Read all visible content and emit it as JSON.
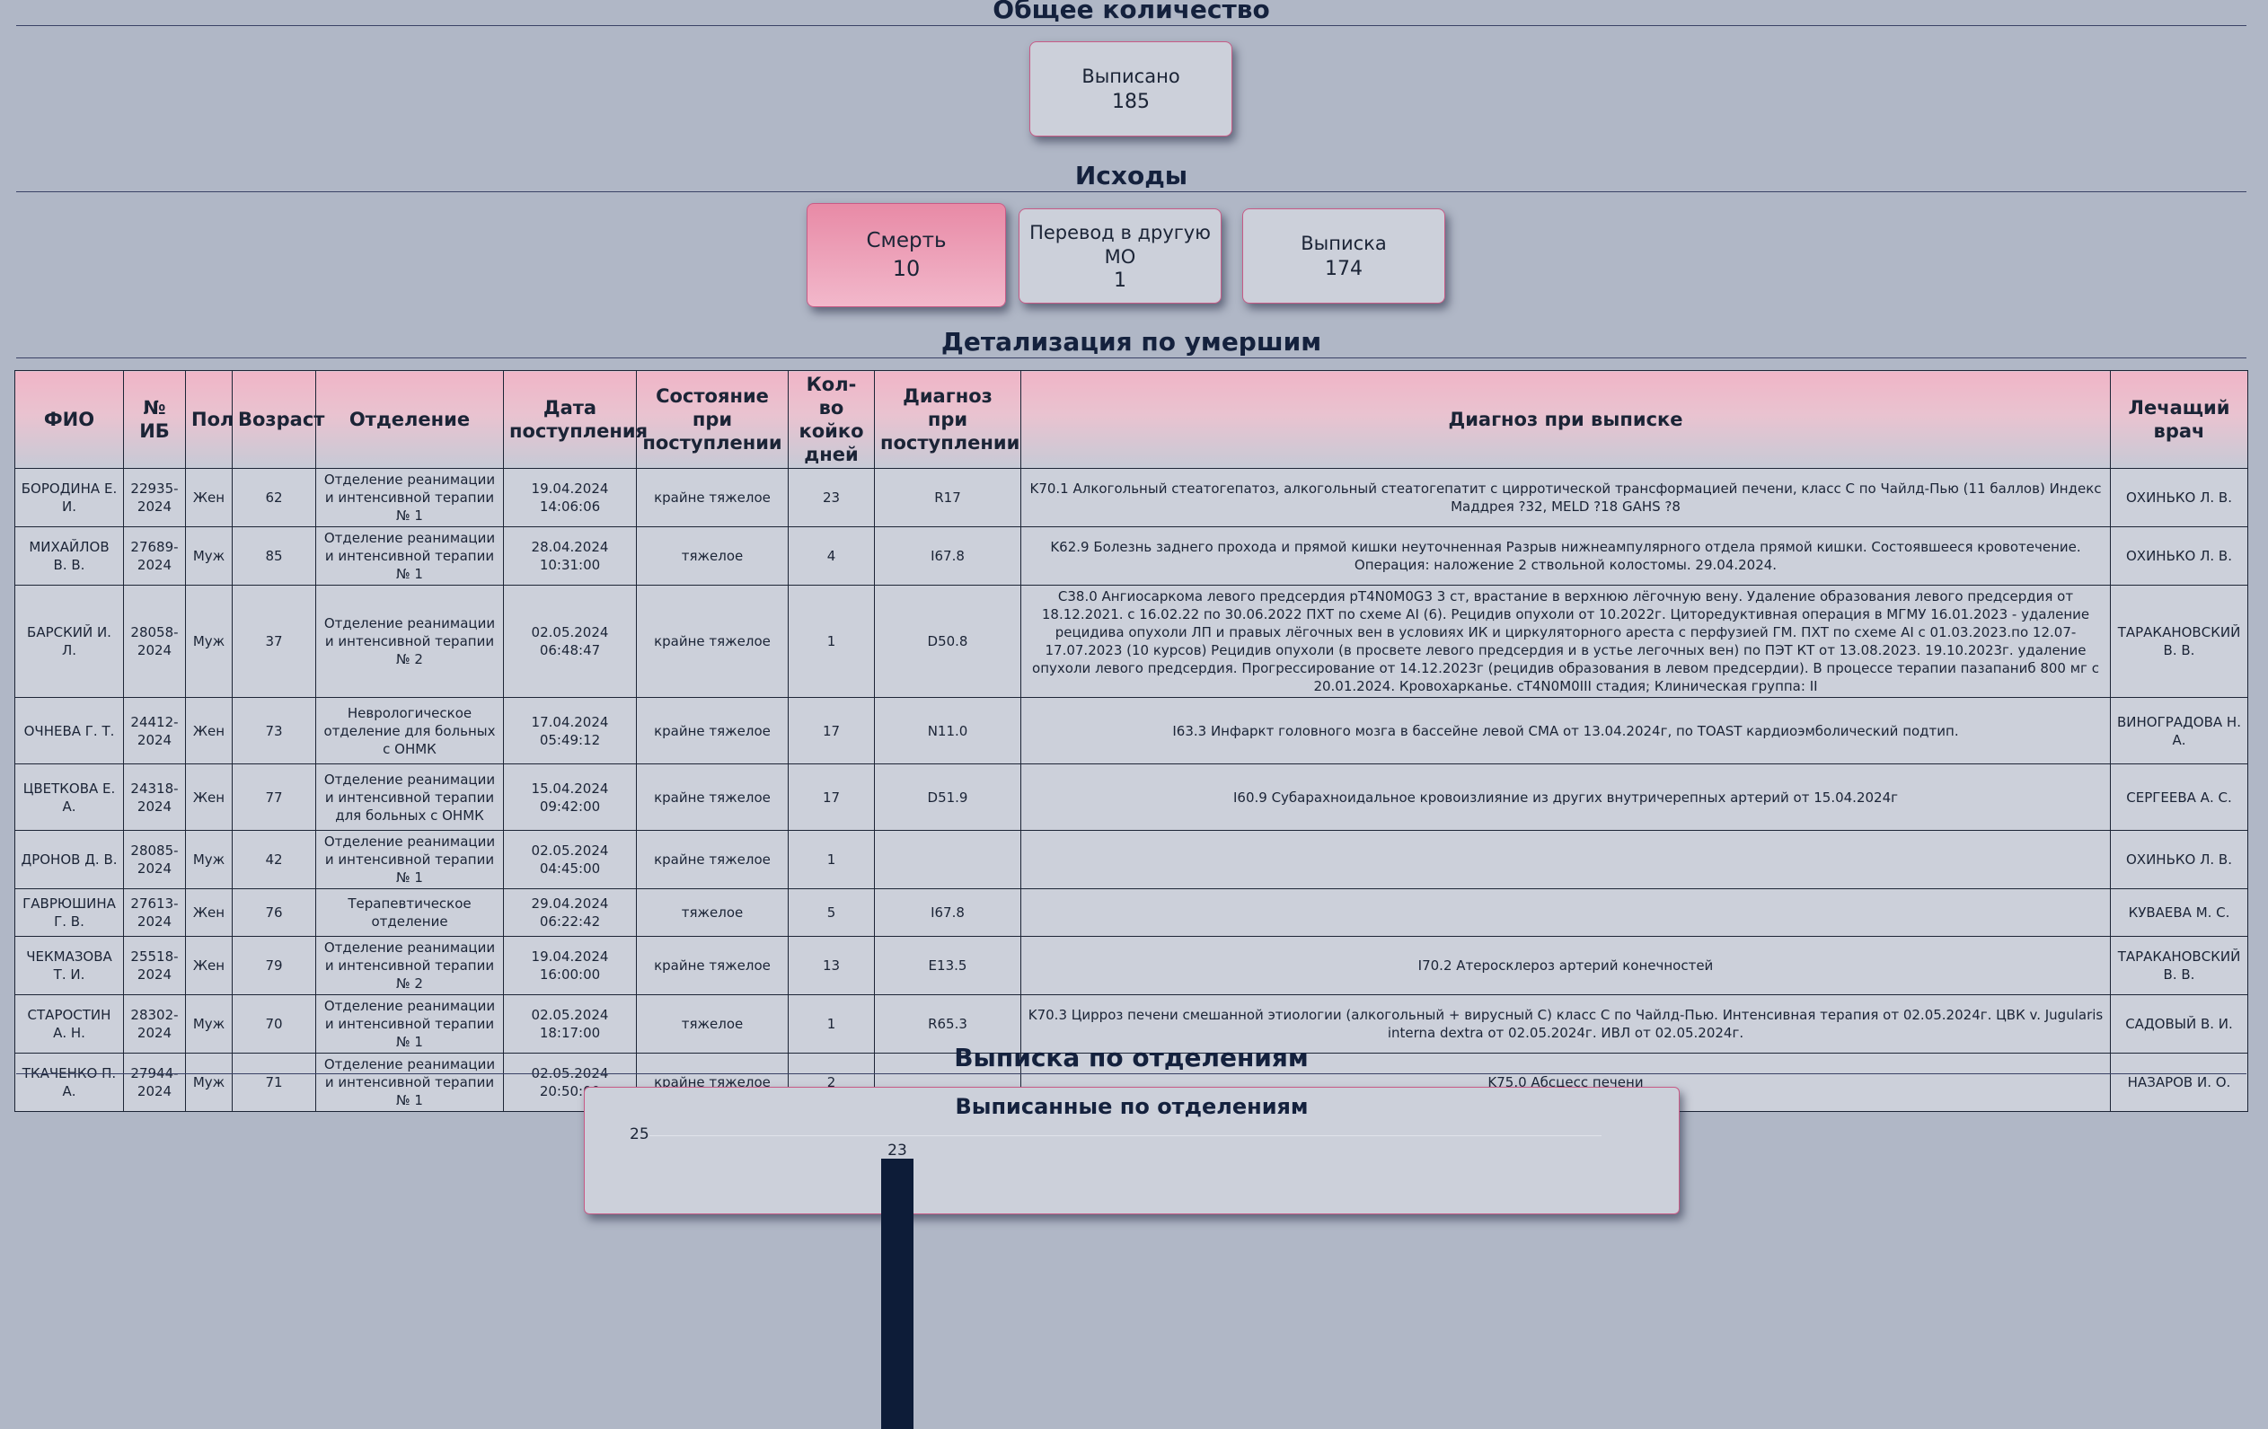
{
  "sections": {
    "total_title": "Общее количество",
    "outcomes_title": "Исходы",
    "deceased_title": "Детализация по умершим",
    "dept_title": "Выписка по отделениям"
  },
  "total": {
    "label": "Выписано",
    "value": "185"
  },
  "outcomes": [
    {
      "label": "Смерть",
      "value": "10"
    },
    {
      "label": "Перевод в другую МО",
      "value": "1"
    },
    {
      "label": "Выписка",
      "value": "174"
    }
  ],
  "table": {
    "headers": [
      "ФИО",
      "№ ИБ",
      "Пол",
      "Возраст",
      "Отделение",
      "Дата поступления",
      "Состояние при поступлении",
      "Кол-во койко дней",
      "Диагноз при поступлении",
      "Диагноз при выписке",
      "Лечащий врач"
    ],
    "rows": [
      [
        "БОРОДИНА Е. И.",
        "22935-2024",
        "Жен",
        "62",
        "Отделение реанимации и интенсивной терапии № 1",
        "19.04.2024 14:06:06",
        "крайне тяжелое",
        "23",
        "R17",
        "K70.1 Алкогольный стеатогепатоз, алкогольный стеатогепатит с цирротической трансформацией печени, класс С по Чайлд-Пью (11 баллов) Индекс Маддрея ?32, MELD ?18 GAHS ?8",
        "ОХИНЬКО Л. В."
      ],
      [
        "МИХАЙЛОВ В. В.",
        "27689-2024",
        "Муж",
        "85",
        "Отделение реанимации и интенсивной терапии № 1",
        "28.04.2024 10:31:00",
        "тяжелое",
        "4",
        "I67.8",
        "K62.9 Болезнь заднего прохода и прямой кишки неуточненная Разрыв нижнеампулярного отдела прямой кишки. Состоявшееся кровотечение. Операция: наложение 2 ствольной колостомы. 29.04.2024.",
        "ОХИНЬКО Л. В."
      ],
      [
        "БАРСКИЙ И. Л.",
        "28058-2024",
        "Муж",
        "37",
        "Отделение реанимации и интенсивной терапии № 2",
        "02.05.2024 06:48:47",
        "крайне тяжелое",
        "1",
        "D50.8",
        "C38.0 Ангиосаркома левого предсердия pT4N0M0G3 3 ст, врастание в верхнюю лёгочную вену. Удаление образования левого предсердия от 18.12.2021. с 16.02.22 по 30.06.2022 ПХТ по схеме AI (6). Рецидив опухоли от 10.2022г. Циторедуктивная операция в МГМУ 16.01.2023 - удаление рецидива опухоли ЛП и правых лёгочных вен в условиях ИК и циркуляторного ареста с перфузией ГМ. ПХТ по схеме AI с 01.03.2023.по 12.07-17.07.2023 (10 курсов) Рецидив опухоли (в просвете левого предсердия и в устье легочных вен) по ПЭТ КТ от 13.08.2023. 19.10.2023г. удаление опухоли левого предсердия. Прогрессирование от 14.12.2023г (рецидив образования в левом предсердии). В процессе терапии пазапаниб 800 мг с 20.01.2024. Кровохарканье. cT4N0M0III стадия; Клиническая группа: II",
        "ТАРАКАНОВСКИЙ В. В."
      ],
      [
        "ОЧНЕВА Г. Т.",
        "24412-2024",
        "Жен",
        "73",
        "Неврологическое отделение для больных с ОНМК",
        "17.04.2024 05:49:12",
        "крайне тяжелое",
        "17",
        "N11.0",
        "I63.3 Инфаркт головного мозга в бассейне левой СМА от 13.04.2024г, по TOAST кардиоэмболический подтип.",
        "ВИНОГРАДОВА Н. А."
      ],
      [
        "ЦВЕТКОВА Е. А.",
        "24318-2024",
        "Жен",
        "77",
        "Отделение реанимации и интенсивной терапии для больных с ОНМК",
        "15.04.2024 09:42:00",
        "крайне тяжелое",
        "17",
        "D51.9",
        "I60.9 Субарахноидальное кровоизлияние из других внутричерепных артерий от 15.04.2024г",
        "СЕРГЕЕВА А. С."
      ],
      [
        "ДРОНОВ Д. В.",
        "28085-2024",
        "Муж",
        "42",
        "Отделение реанимации и интенсивной терапии № 1",
        "02.05.2024 04:45:00",
        "крайне тяжелое",
        "1",
        "",
        "",
        "ОХИНЬКО Л. В."
      ],
      [
        "ГАВРЮШИНА Г. В.",
        "27613-2024",
        "Жен",
        "76",
        "Терапевтическое отделение",
        "29.04.2024 06:22:42",
        "тяжелое",
        "5",
        "I67.8",
        "",
        "КУВАЕВА М. С."
      ],
      [
        "ЧЕКМАЗОВА Т. И.",
        "25518-2024",
        "Жен",
        "79",
        "Отделение реанимации и интенсивной терапии № 2",
        "19.04.2024 16:00:00",
        "крайне тяжелое",
        "13",
        "E13.5",
        "I70.2 Атеросклероз артерий конечностей",
        "ТАРАКАНОВСКИЙ В. В."
      ],
      [
        "СТАРОСТИН А. Н.",
        "28302-2024",
        "Муж",
        "70",
        "Отделение реанимации и интенсивной терапии № 1",
        "02.05.2024 18:17:00",
        "тяжелое",
        "1",
        "R65.3",
        "K70.3 Цирроз печени смешанной этиологии (алкогольный + вирусный С) класс С по Чайлд-Пью. Интенсивная терапия от 02.05.2024г. ЦВК v. Jugularis interna dextra от 02.05.2024г. ИВЛ от 02.05.2024г.",
        "САДОВЫЙ В. И."
      ],
      [
        "ТКАЧЕНКО П. А.",
        "27944-2024",
        "Муж",
        "71",
        "Отделение реанимации и интенсивной терапии № 1",
        "02.05.2024 20:50:00",
        "крайне тяжелое",
        "2",
        "",
        "K75.0 Абсцесс печени",
        "НАЗАРОВ И. О."
      ]
    ]
  },
  "chart_data": {
    "type": "bar",
    "title": "Выписанные по отделениям",
    "visible_ytick": "25",
    "visible_bar_label": "23",
    "values": [
      23
    ],
    "ylim": [
      0,
      25
    ],
    "bar_color": "#0d1c38"
  }
}
